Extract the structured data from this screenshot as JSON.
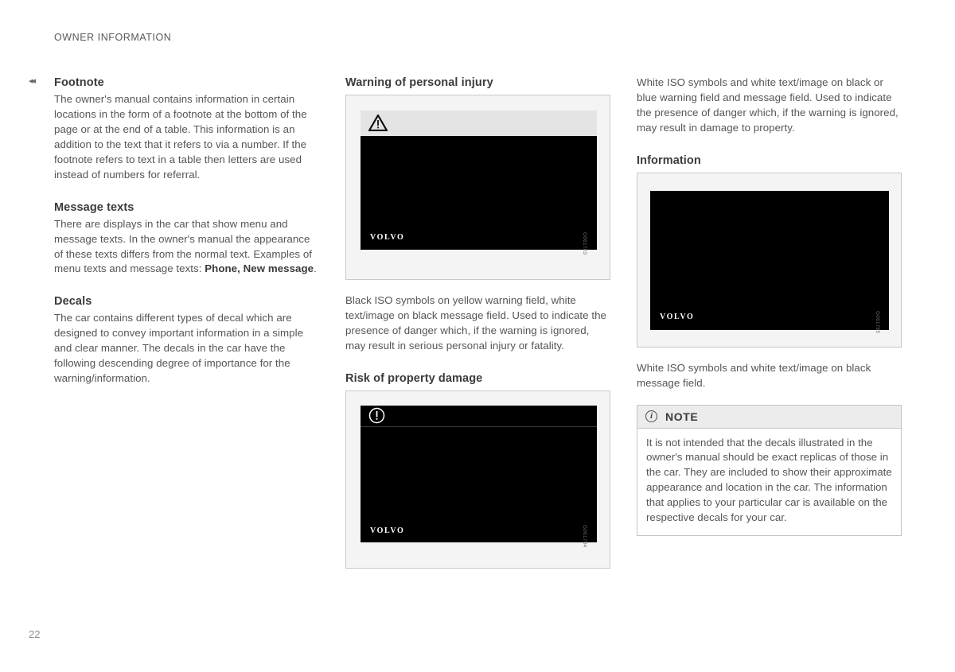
{
  "header": {
    "running_title": "OWNER INFORMATION",
    "continuation_marker": "◂◂"
  },
  "folio": {
    "page_number": "22"
  },
  "columns": {
    "left": {
      "sections": [
        {
          "title": "Footnote",
          "paragraphs": [
            "The owner's manual contains information in certain locations in the form of a footnote at the bottom of the page or at the end of a table. This information is an addition to the text that it refers to via a number. If the footnote refers to text in a table then letters are used instead of numbers for referral."
          ]
        },
        {
          "title": "Message texts",
          "paragraph_lead": "There are displays in the car that show menu and message texts. In the owner's manual the appearance of these texts differs from the normal text. Examples of menu texts and message texts: ",
          "paragraph_bold": "Phone, New message",
          "paragraph_tail": "."
        },
        {
          "title": "Decals",
          "paragraphs": [
            "The car contains different types of decal which are designed to convey important information in a simple and clear manner. The decals in the car have the following descending degree of importance for the warning/information."
          ]
        }
      ]
    },
    "middle": {
      "figure_1": {
        "title": "Warning of personal injury",
        "icon": "warning-triangle-icon",
        "brand_word": "VOLVO",
        "image_code": "G061783",
        "band_color": "#e4e4e4",
        "field_color": "#000000"
      },
      "caption_1": "Black ISO symbols on yellow warning field, white text/image on black message field. Used to indicate the presence of danger which, if the warning is ignored, may result in serious personal injury or fatality.",
      "figure_2": {
        "title": "Risk of property damage",
        "icon": "exclamation-circle-icon",
        "brand_word": "VOLVO",
        "image_code": "G061784",
        "band_color": "#000000",
        "field_color": "#000000"
      }
    },
    "right": {
      "caption_top": "White ISO symbols and white text/image on black or blue warning field and message field. Used to indicate the presence of danger which, if the warning is ignored, may result in damage to property.",
      "figure_3": {
        "title": "Information",
        "brand_word": "VOLVO",
        "image_code": "G061785",
        "field_color": "#000000"
      },
      "caption_bottom": "White ISO symbols and white text/image on black message field.",
      "note": {
        "icon": "info-circle-icon",
        "icon_glyph": "i",
        "title": "NOTE",
        "text": "It is not intended that the decals illustrated in the owner's manual should be exact replicas of those in the car. They are included to show their approximate appearance and location in the car. The information that applies to your particular car is available on the respective decals for your car."
      }
    }
  }
}
